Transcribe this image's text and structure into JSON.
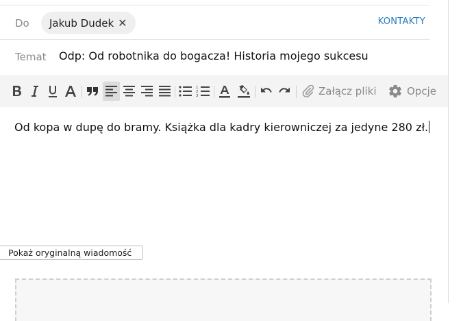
{
  "header": {
    "to_label": "Do",
    "recipient_name": "Jakub Dudek",
    "remove_glyph": "✕",
    "contacts_label": "KONTAKTY",
    "subject_label": "Temat",
    "subject_value": "Odp: Od robotnika do bogacza! Historia mojego sukcesu"
  },
  "toolbar": {
    "attach_label": "Załącz pliki",
    "options_label": "Opcje",
    "buttons": [
      "bold-icon",
      "italic-icon",
      "underline-icon",
      "font-size-icon",
      "quote-icon",
      "align-left-icon",
      "align-center-icon",
      "align-right-icon",
      "align-justify-icon",
      "bullet-list-icon",
      "numbered-list-icon",
      "text-color-icon",
      "highlight-icon",
      "undo-icon",
      "redo-icon",
      "paperclip-icon",
      "gear-icon"
    ],
    "active_button": "align-left-icon"
  },
  "editor": {
    "body_text": "Od kopa w dupę do bramy. Książka dla kadry kierowniczej za jedyne 280 zł."
  },
  "footer": {
    "show_original_label": "Pokaż oryginalną wiadomość"
  },
  "colors": {
    "accent": "#2a7bbf",
    "toolbar_bg": "#f4f4f4",
    "chip_bg": "#efefef"
  }
}
